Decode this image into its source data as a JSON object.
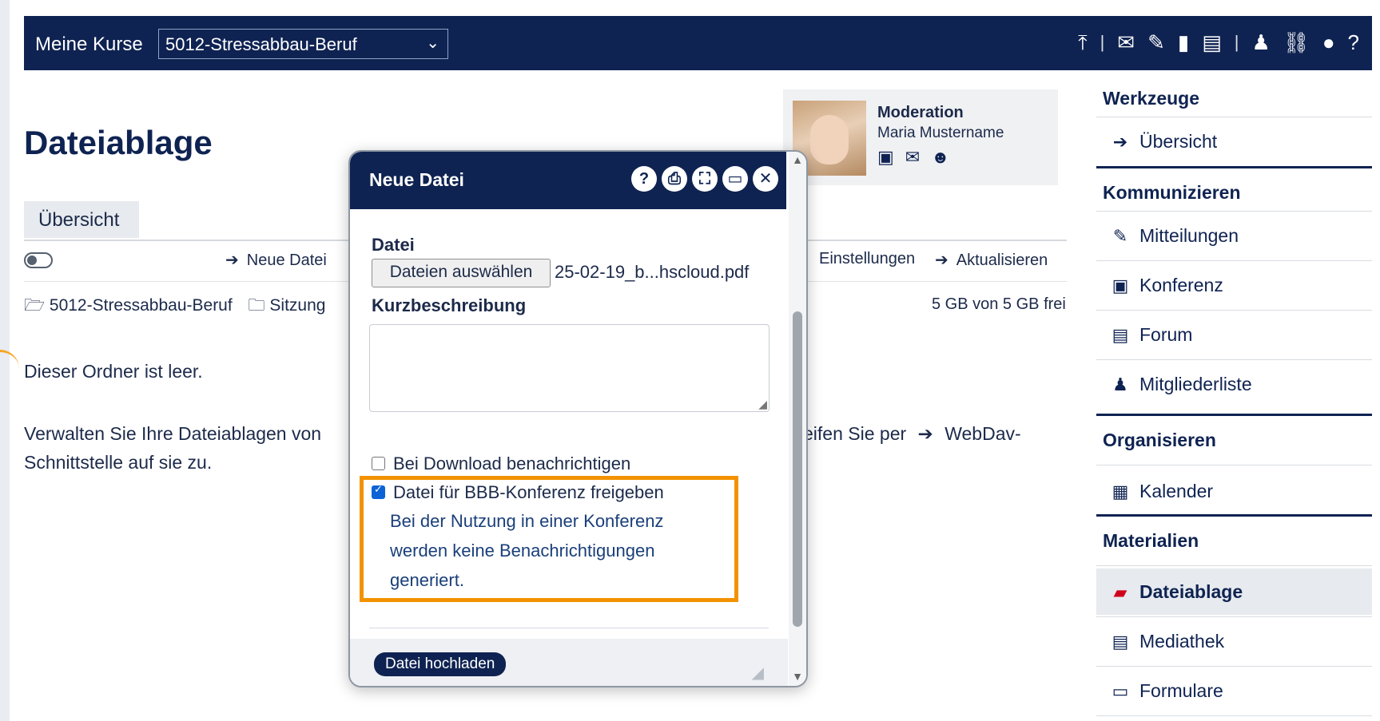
{
  "topbar": {
    "label": "Meine Kurse",
    "course_selected": "5012-Stressabbau-Beruf",
    "icons": [
      "upload-icon",
      "mail-icon",
      "edit-icon",
      "bookmark-icon",
      "notes-icon",
      "user-icon",
      "link-icon",
      "support-icon",
      "help-icon"
    ]
  },
  "page": {
    "title": "Dateiablage",
    "tab_overview": "Übersicht",
    "action_new_file": "Neue Datei",
    "action_settings": "Einstellungen",
    "action_refresh": "Aktualisieren",
    "breadcrumb_root": "5012-Stressabbau-Beruf",
    "breadcrumb_folder": "Sitzung",
    "quota": "5 GB von 5 GB frei",
    "empty_text": "Dieser Ordner ist leer.",
    "webdav_line1": "Verwalten Sie Ihre Dateiablagen von",
    "webdav_line1_right": "eifen Sie per",
    "webdav_link": "WebDav-",
    "webdav_line2_link": "Schnittstelle",
    "webdav_line2_rest": " auf sie zu."
  },
  "moderation": {
    "title": "Moderation",
    "name": "Maria Mustername"
  },
  "sidebar": {
    "werkzeuge": "Werkzeuge",
    "uebersicht": "Übersicht",
    "kommunizieren": "Kommunizieren",
    "mitteilungen": "Mitteilungen",
    "konferenz": "Konferenz",
    "forum": "Forum",
    "mitgliederliste": "Mitgliederliste",
    "organisieren": "Organisieren",
    "kalender": "Kalender",
    "materialien": "Materialien",
    "dateiablage": "Dateiablage",
    "mediathek": "Mediathek",
    "formulare": "Formulare"
  },
  "dialog": {
    "title": "Neue Datei",
    "file_label": "Datei",
    "file_button": "Dateien auswählen",
    "file_name": "25-02-19_b...hscloud.pdf",
    "description_label": "Kurzbeschreibung",
    "notify_label": "Bei Download benachrichtigen",
    "notify_checked": false,
    "bbb_label": "Datei für BBB-Konferenz freigeben",
    "bbb_checked": true,
    "hint_line1": "Bei der Nutzung in einer Konferenz",
    "hint_line2": "werden keine Benachrichtigungen",
    "hint_line3": "generiert.",
    "upload_button": "Datei hochladen"
  },
  "colors": {
    "navy": "#0f2352",
    "highlight": "#f39200",
    "active_icon": "#d0021b"
  }
}
